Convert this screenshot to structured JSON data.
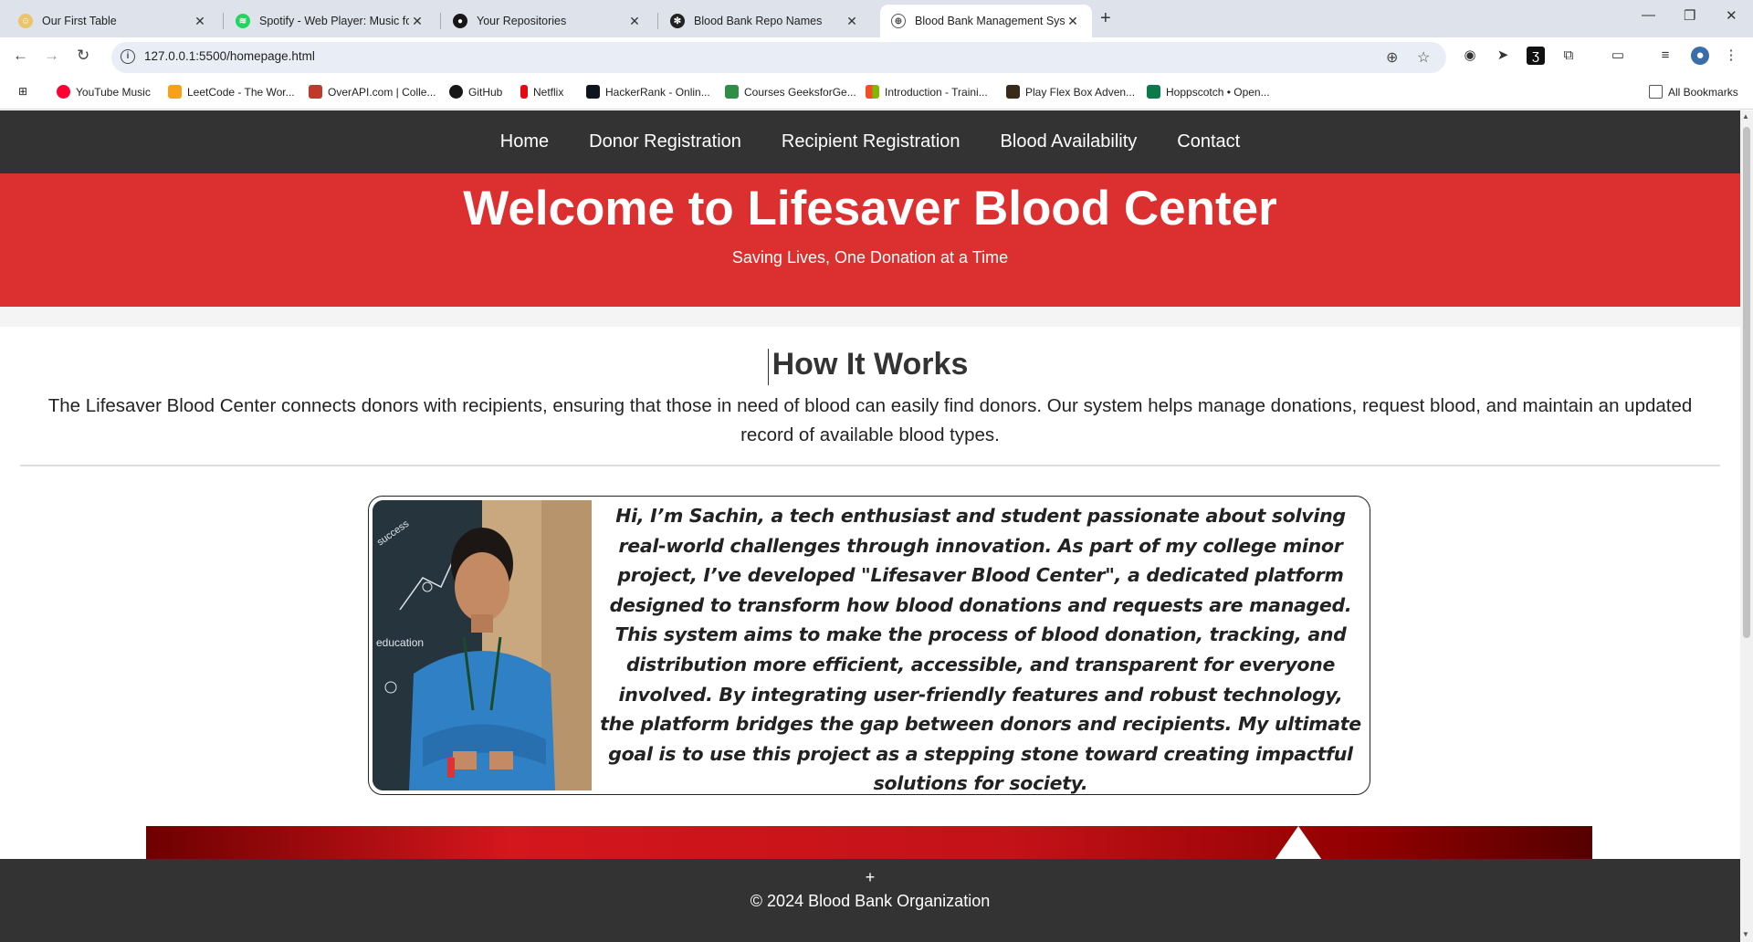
{
  "browser": {
    "tabs": [
      {
        "title": "Our First Table",
        "active": false,
        "icon": "emoji-icon"
      },
      {
        "title": "Spotify - Web Player: Music for",
        "active": false,
        "icon": "spotify-icon"
      },
      {
        "title": "Your Repositories",
        "active": false,
        "icon": "github-icon"
      },
      {
        "title": "Blood Bank Repo Names",
        "active": false,
        "icon": "openai-icon"
      },
      {
        "title": "Blood Bank Management Syste",
        "active": true,
        "icon": "globe-icon"
      }
    ],
    "new_tab_label": "+",
    "url": "127.0.0.1:5500/homepage.html",
    "bookmarks": [
      {
        "label": "YouTube Music",
        "color": "#ff0033"
      },
      {
        "label": "LeetCode - The Wor...",
        "color": "#f89f1b"
      },
      {
        "label": "OverAPI.com | Colle...",
        "color": "#c0392b"
      },
      {
        "label": "GitHub",
        "color": "#181717"
      },
      {
        "label": "Netflix",
        "color": "#e50914"
      },
      {
        "label": "HackerRank - Onlin...",
        "color": "#1ba94c"
      },
      {
        "label": "Courses GeeksforGe...",
        "color": "#2f8d46"
      },
      {
        "label": "Introduction - Traini...",
        "color": "#00a4ef"
      },
      {
        "label": "Play Flex Box Adven...",
        "color": "#3a2a1a"
      },
      {
        "label": "Hoppscotch • Open...",
        "color": "#0b5"
      }
    ],
    "all_bookmarks_label": "All Bookmarks"
  },
  "site": {
    "nav": [
      "Home",
      "Donor Registration",
      "Recipient Registration",
      "Blood Availability",
      "Contact"
    ],
    "hero_title": "Welcome to Lifesaver Blood Center",
    "hero_subtitle": "Saving Lives, One Donation at a Time",
    "how_title": "How It Works",
    "how_text": "The Lifesaver Blood Center connects donors with recipients, ensuring that those in need of blood can easily find donors. Our system helps manage donations, request blood, and maintain an updated record of available blood types.",
    "about_text": "Hi, I’m Sachin, a tech enthusiast and student passionate about solving real-world challenges through innovation. As part of my college minor project, I’ve developed \"Lifesaver Blood Center\", a dedicated platform designed to transform how blood donations and requests are managed. This system aims to make the process of blood donation, tracking, and distribution more efficient, accessible, and transparent for everyone involved. By integrating user-friendly features and robust technology, the platform bridges the gap between donors and recipients. My ultimate goal is to use this project as a stepping stone toward creating impactful solutions for society.",
    "photo_words": [
      "success",
      "education"
    ],
    "footer_plus": "+",
    "footer_text": "© 2024 Blood Bank Organization"
  },
  "colors": {
    "nav_bg": "#333333",
    "hero_bg": "#dc2f2f",
    "footer_bg": "#333333"
  }
}
